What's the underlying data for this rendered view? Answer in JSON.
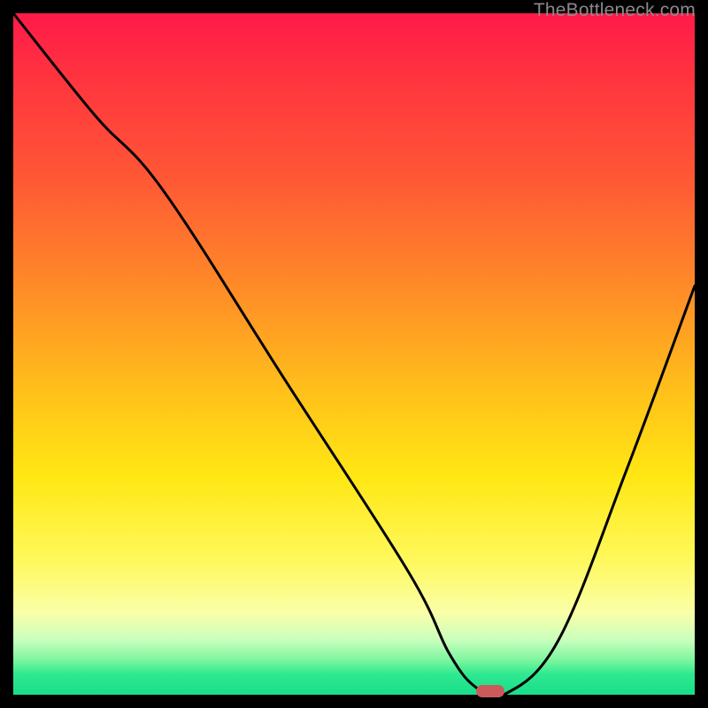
{
  "watermark": "TheBottleneck.com",
  "colors": {
    "frame": "#000000",
    "marker": "#cc5a5a",
    "curve": "#000000"
  },
  "chart_data": {
    "type": "line",
    "title": "",
    "xlabel": "",
    "ylabel": "",
    "xlim": [
      0,
      100
    ],
    "ylim": [
      0,
      100
    ],
    "grid": false,
    "legend": false,
    "series": [
      {
        "name": "bottleneck-curve",
        "x": [
          0,
          12,
          22,
          40,
          58,
          64,
          68,
          72,
          80,
          90,
          100
        ],
        "values": [
          100,
          85,
          74,
          46,
          18,
          6,
          1,
          0,
          8,
          33,
          60
        ]
      }
    ],
    "marker": {
      "x": 70,
      "y": 0
    },
    "annotations": []
  }
}
